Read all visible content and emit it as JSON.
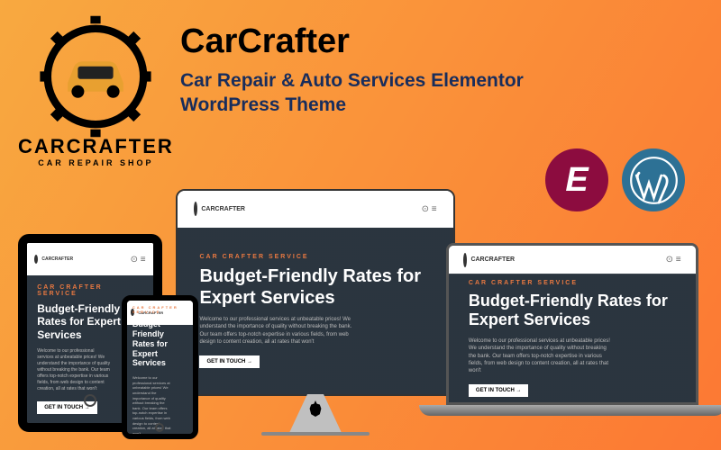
{
  "brand": {
    "name": "CARCRAFTER",
    "tagline": "CAR REPAIR SHOP"
  },
  "header": {
    "title": "CarCrafter",
    "subtitle": "Car Repair & Auto Services Elementor WordPress Theme"
  },
  "badges": {
    "elementor": "E",
    "wordpress": "WordPress"
  },
  "screen": {
    "nav_logo": "CARCRAFTER",
    "kicker": "CAR CRAFTER SERVICE",
    "hero_title": "Budget-Friendly Rates for Expert Services",
    "hero_desc": "Welcome to our professional services at unbeatable prices! We understand the importance of quality without breaking the bank. Our team offers top-notch expertise in various fields, from web design to content creation, all at rates that won't",
    "cta": "GET IN TOUCH →"
  }
}
